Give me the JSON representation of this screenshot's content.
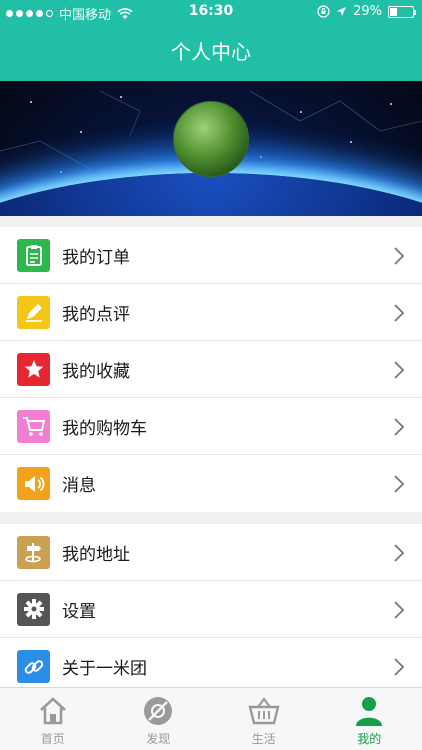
{
  "status_bar": {
    "carrier": "中国移动",
    "time": "16:30",
    "battery": "29%"
  },
  "nav": {
    "title": "个人中心"
  },
  "menu_group_1": [
    {
      "label": "我的订单",
      "icon": "clipboard-icon",
      "color": "#2db84d"
    },
    {
      "label": "我的点评",
      "icon": "pencil-icon",
      "color": "#f5c518"
    },
    {
      "label": "我的收藏",
      "icon": "star-icon",
      "color": "#e8262f"
    },
    {
      "label": "我的购物车",
      "icon": "cart-icon",
      "color": "#f27fd0"
    },
    {
      "label": "消息",
      "icon": "speaker-icon",
      "color": "#f2a21a"
    }
  ],
  "menu_group_2": [
    {
      "label": "我的地址",
      "icon": "signpost-icon",
      "color": "#caa052"
    },
    {
      "label": "设置",
      "icon": "gear-icon",
      "color": "#555555"
    },
    {
      "label": "关于一米团",
      "icon": "link-icon",
      "color": "#2a8de8"
    }
  ],
  "tabbar": [
    {
      "label": "首页",
      "icon": "home-icon"
    },
    {
      "label": "发现",
      "icon": "compass-icon"
    },
    {
      "label": "生活",
      "icon": "basket-icon"
    },
    {
      "label": "我的",
      "icon": "person-icon"
    }
  ],
  "colors": {
    "accent": "#21c0a6",
    "tab_active": "#13a04a"
  }
}
